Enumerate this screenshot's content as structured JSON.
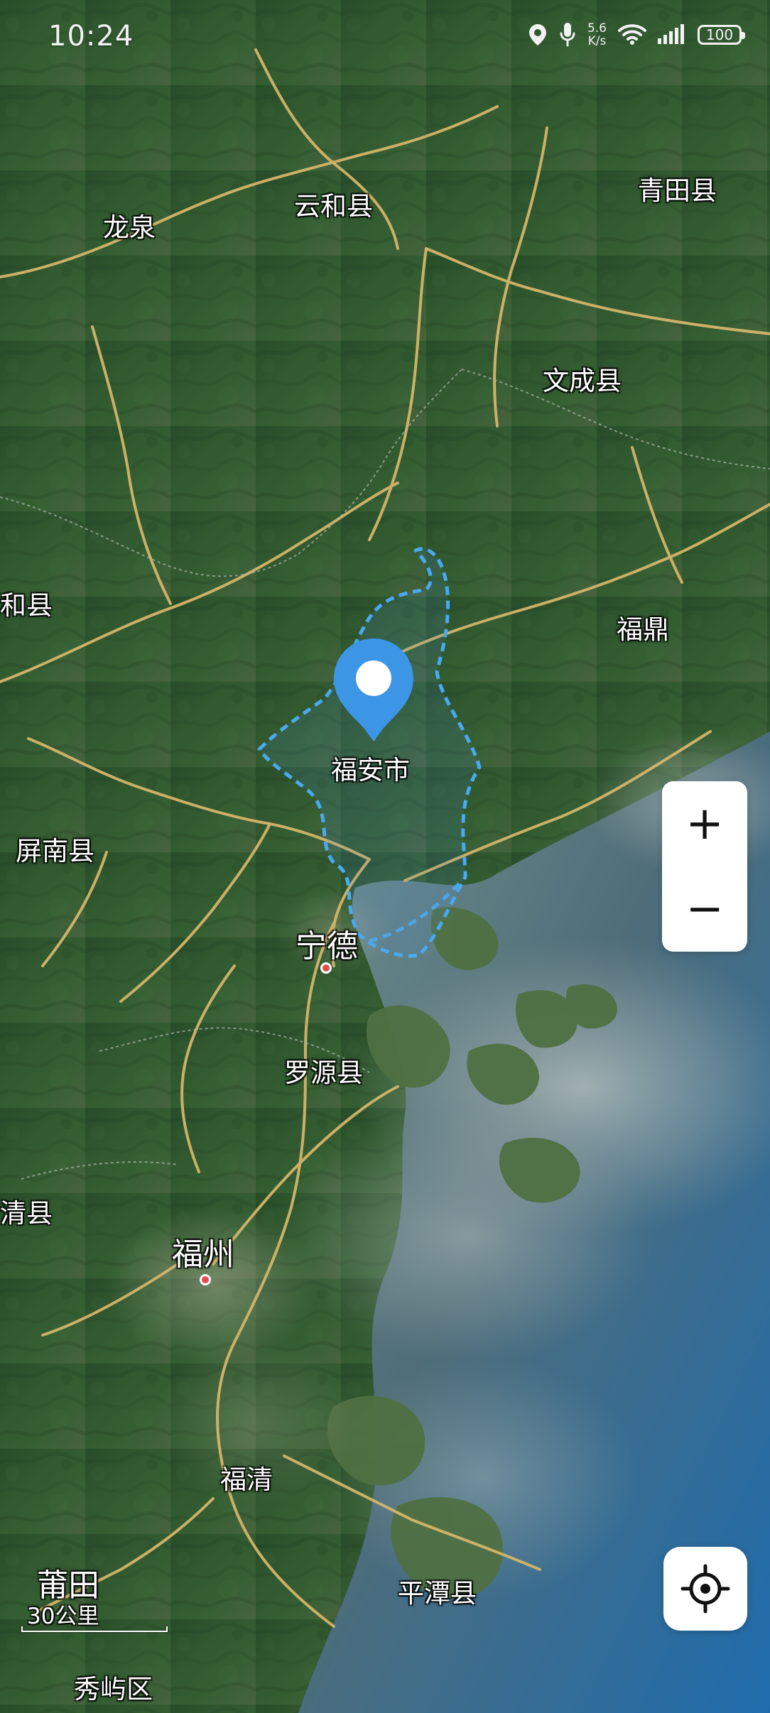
{
  "status_bar": {
    "time": "10:24",
    "net_speed_value": "5.6",
    "net_speed_unit": "K/s",
    "battery": "100",
    "icons": [
      "location-icon",
      "microphone-icon",
      "wifi-icon",
      "signal-icon",
      "battery-icon"
    ]
  },
  "map": {
    "labels": {
      "longquan": "龙泉",
      "yunhe": "云和县",
      "qingtian": "青田县",
      "wencheng": "文成县",
      "zhenghe": "和县",
      "fuding": "福鼎",
      "fuan": "福安市",
      "pingnan": "屏南县",
      "ningde": "宁德",
      "luoyuan": "罗源县",
      "minqing": "清县",
      "fuzhou": "福州",
      "fuqing": "福清",
      "putian": "莆田",
      "pingtan": "平潭县",
      "xiuyu": "秀屿区"
    },
    "scale": "30公里",
    "colors": {
      "land": "#2f5c31",
      "sea": "#2f78a8",
      "road": "#d6b66d",
      "boundary": "#3ba4f0",
      "pin": "#3b95e6"
    }
  },
  "controls": {
    "zoom_in": "+",
    "zoom_out": "−",
    "locate_icon": "locate-icon"
  }
}
